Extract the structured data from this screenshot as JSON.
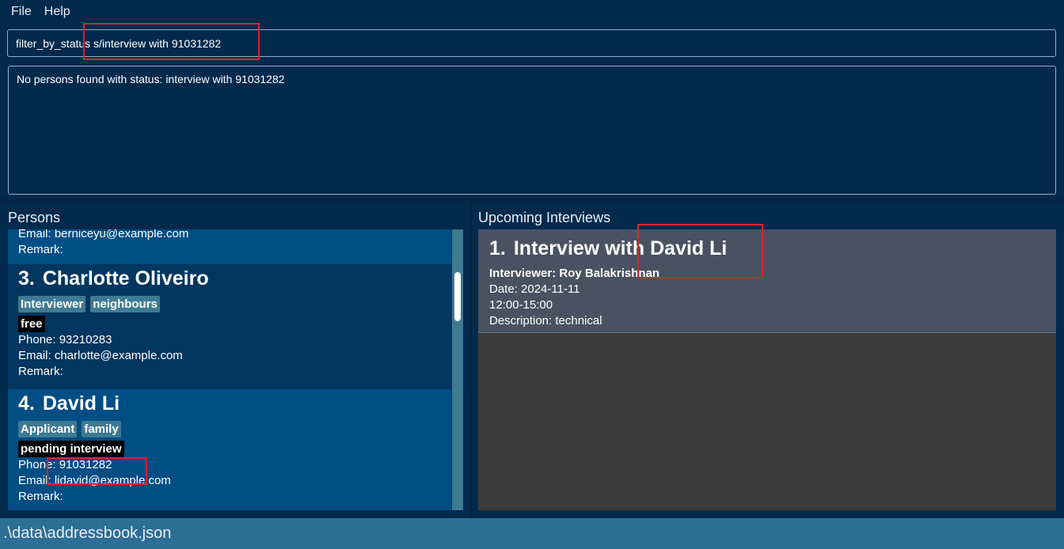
{
  "menu": {
    "file": "File",
    "help": "Help"
  },
  "command": {
    "value": "filter_by_status s/interview with 91031282"
  },
  "result": {
    "text": "No persons found with status: interview with 91031282"
  },
  "persons_panel": {
    "title": "Persons",
    "partial": {
      "email": "Email: berniceyu@example.com",
      "remark": "Remark:"
    },
    "cards": [
      {
        "index": "3.",
        "name": "Charlotte Oliveiro",
        "tags": [
          "Interviewer",
          "neighbours"
        ],
        "status": "free",
        "phone": "Phone: 93210283",
        "email": "Email: charlotte@example.com",
        "remark": "Remark:"
      },
      {
        "index": "4.",
        "name": "David Li",
        "tags": [
          "Applicant",
          "family"
        ],
        "status": "pending interview",
        "phone": "Phone: 91031282",
        "email": "Email: lidavid@example.com",
        "remark": "Remark:"
      }
    ]
  },
  "interviews_panel": {
    "title": "Upcoming Interviews",
    "cards": [
      {
        "index": "1.",
        "title": "Interview with David Li",
        "interviewer": "Interviewer: Roy Balakrishnan",
        "date": "Date: 2024-11-11",
        "time": "12:00-15:00",
        "description": "Description: technical"
      }
    ]
  },
  "statusbar": {
    "path": ".\\data\\addressbook.json"
  },
  "colors": {
    "background": "#022a4d",
    "card_selected": "#004e84",
    "tag": "#3e7b91",
    "statusbar": "#2d6e95",
    "annotation": "#e0202a"
  }
}
